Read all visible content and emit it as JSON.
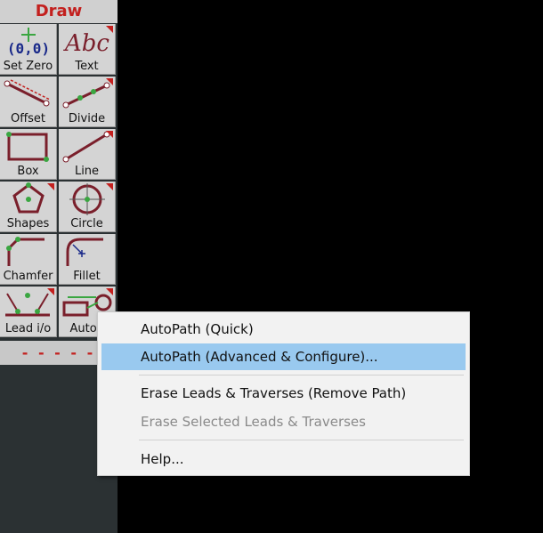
{
  "panel": {
    "title": "Draw",
    "footer": "- - - - -",
    "tools": [
      {
        "label": "Set Zero",
        "icon": "set-zero-icon",
        "submenu": false
      },
      {
        "label": "Text",
        "icon": "text-icon",
        "submenu": true
      },
      {
        "label": "Offset",
        "icon": "offset-icon",
        "submenu": false
      },
      {
        "label": "Divide",
        "icon": "divide-icon",
        "submenu": true
      },
      {
        "label": "Box",
        "icon": "box-icon",
        "submenu": false
      },
      {
        "label": "Line",
        "icon": "line-icon",
        "submenu": true
      },
      {
        "label": "Shapes",
        "icon": "shapes-icon",
        "submenu": true
      },
      {
        "label": "Circle",
        "icon": "circle-icon",
        "submenu": true
      },
      {
        "label": "Chamfer",
        "icon": "chamfer-icon",
        "submenu": false
      },
      {
        "label": "Fillet",
        "icon": "fillet-icon",
        "submenu": false
      },
      {
        "label": "Lead i/o",
        "icon": "lead-io-icon",
        "submenu": true
      },
      {
        "label": "AutoP",
        "icon": "autopath-icon",
        "submenu": true
      }
    ],
    "set_zero_text": "(0,0)",
    "text_icon_glyph": "Abc"
  },
  "context_menu": {
    "items": [
      {
        "label": "AutoPath (Quick)",
        "state": "normal"
      },
      {
        "label": "AutoPath (Advanced & Configure)...",
        "state": "highlighted"
      },
      {
        "label": "Erase Leads & Traverses (Remove Path)",
        "state": "normal"
      },
      {
        "label": "Erase Selected Leads & Traverses",
        "state": "disabled"
      },
      {
        "label": "Help...",
        "state": "normal"
      }
    ]
  },
  "colors": {
    "accent_red": "#c3201e",
    "highlight": "#99c9ef",
    "panel_bg": "#2b3133",
    "node_green": "#3aa641",
    "line_maroon": "#7a1f2b"
  }
}
